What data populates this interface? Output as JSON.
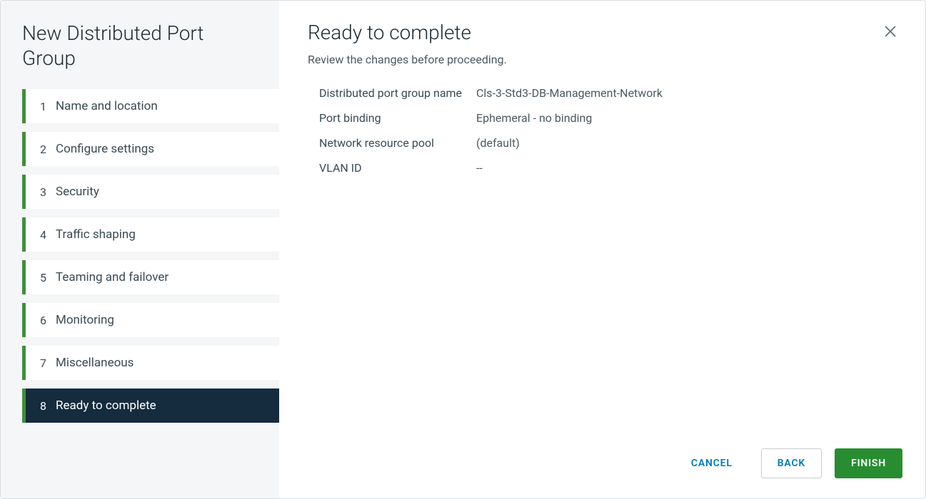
{
  "sidebar": {
    "title": "New Distributed Port Group",
    "steps": [
      {
        "number": "1",
        "label": "Name and location"
      },
      {
        "number": "2",
        "label": "Configure settings"
      },
      {
        "number": "3",
        "label": "Security"
      },
      {
        "number": "4",
        "label": "Traffic shaping"
      },
      {
        "number": "5",
        "label": "Teaming and failover"
      },
      {
        "number": "6",
        "label": "Monitoring"
      },
      {
        "number": "7",
        "label": "Miscellaneous"
      },
      {
        "number": "8",
        "label": "Ready to complete"
      }
    ],
    "active_index": 7
  },
  "main": {
    "title": "Ready to complete",
    "subtitle": "Review the changes before proceeding.",
    "rows": [
      {
        "label": "Distributed port group name",
        "value": "Cls-3-Std3-DB-Management-Network"
      },
      {
        "label": "Port binding",
        "value": "Ephemeral - no binding"
      },
      {
        "label": "Network resource pool",
        "value": "(default)"
      },
      {
        "label": "VLAN ID",
        "value": "--"
      }
    ]
  },
  "footer": {
    "cancel": "CANCEL",
    "back": "BACK",
    "finish": "FINISH"
  }
}
